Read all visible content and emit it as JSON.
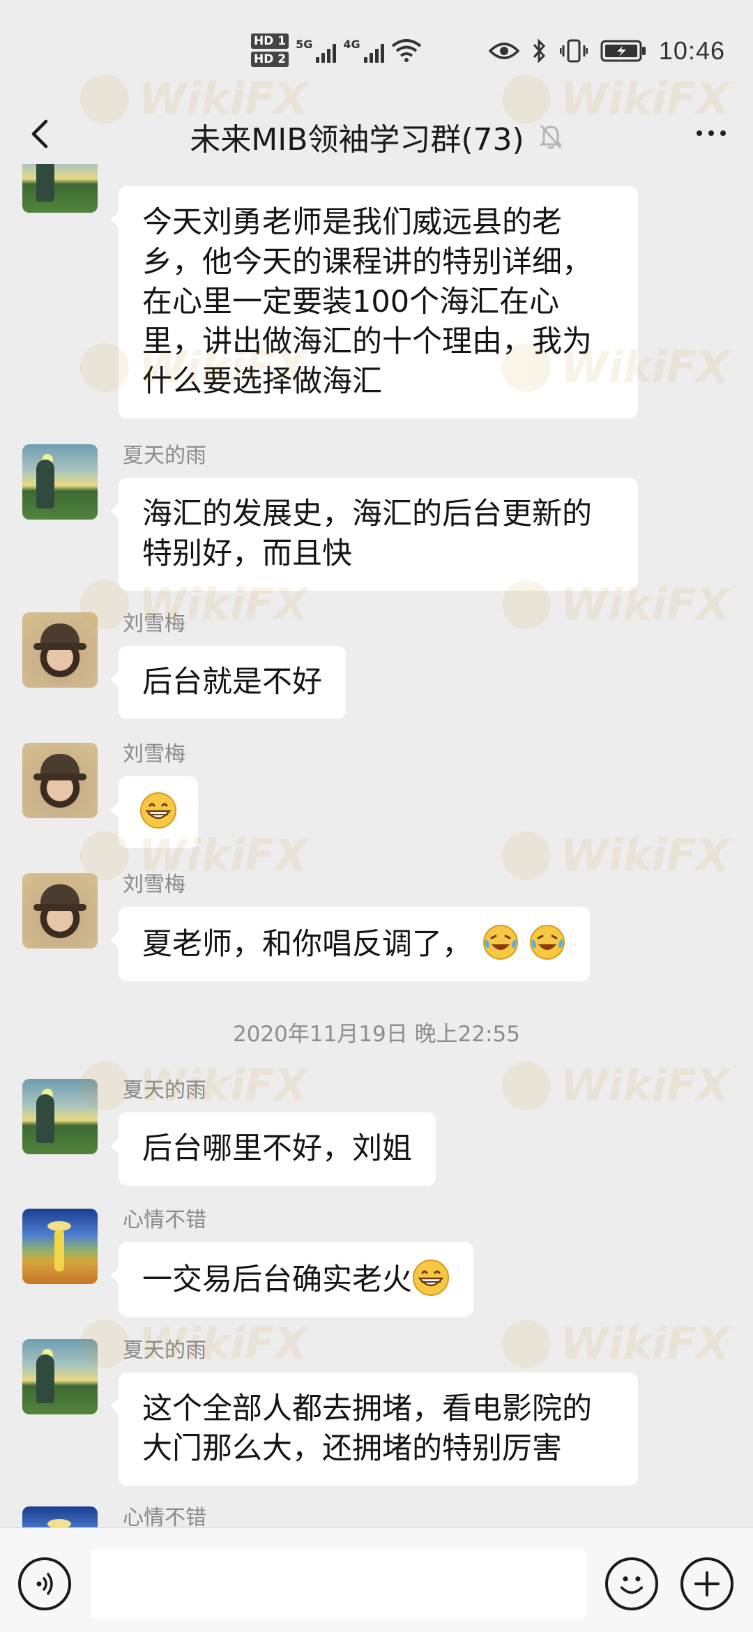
{
  "status_bar": {
    "hd1": "HD 1",
    "hd2": "HD 2",
    "sim1_network": "5G",
    "sim2_network": "4G",
    "time": "10:46"
  },
  "header": {
    "title": "未来MIB领袖学习群(73)",
    "icons": [
      "back-arrow",
      "mute-bell",
      "more-dots"
    ]
  },
  "chat": {
    "messages": [
      {
        "sender": "",
        "avatar": "summer",
        "text": "今天刘勇老师是我们威远县的老乡，他今天的课程讲的特别详细，在心里一定要装100个海汇在心里，讲出做海汇的十个理由，我为什么要选择做海汇"
      },
      {
        "sender": "夏天的雨",
        "avatar": "summer",
        "text": "海汇的发展史，海汇的后台更新的特别好，而且快"
      },
      {
        "sender": "刘雪梅",
        "avatar": "liu",
        "text": "后台就是不好"
      },
      {
        "sender": "刘雪梅",
        "avatar": "liu",
        "emoji": "grinning"
      },
      {
        "sender": "刘雪梅",
        "avatar": "liu",
        "text": "夏老师，和你唱反调了，",
        "emoji": "laughing-tears x2"
      },
      {
        "sender": "夏天的雨",
        "avatar": "summer",
        "text": "后台哪里不好，刘姐"
      },
      {
        "sender": "心情不错",
        "avatar": "mood",
        "text": "一交易后台确实老火",
        "emoji": "grinning"
      },
      {
        "sender": "夏天的雨",
        "avatar": "summer",
        "text": "这个全部人都去拥堵，看电影院的大门那么大，还拥堵的特别厉害"
      },
      {
        "sender": "心情不错",
        "avatar": "mood"
      }
    ],
    "timestamp": "2020年11月19日 晚上22:55"
  },
  "watermark": "WikiFX",
  "input_bar": {
    "placeholder": "",
    "icons": [
      "voice-icon",
      "emoji-icon",
      "plus-icon"
    ]
  }
}
